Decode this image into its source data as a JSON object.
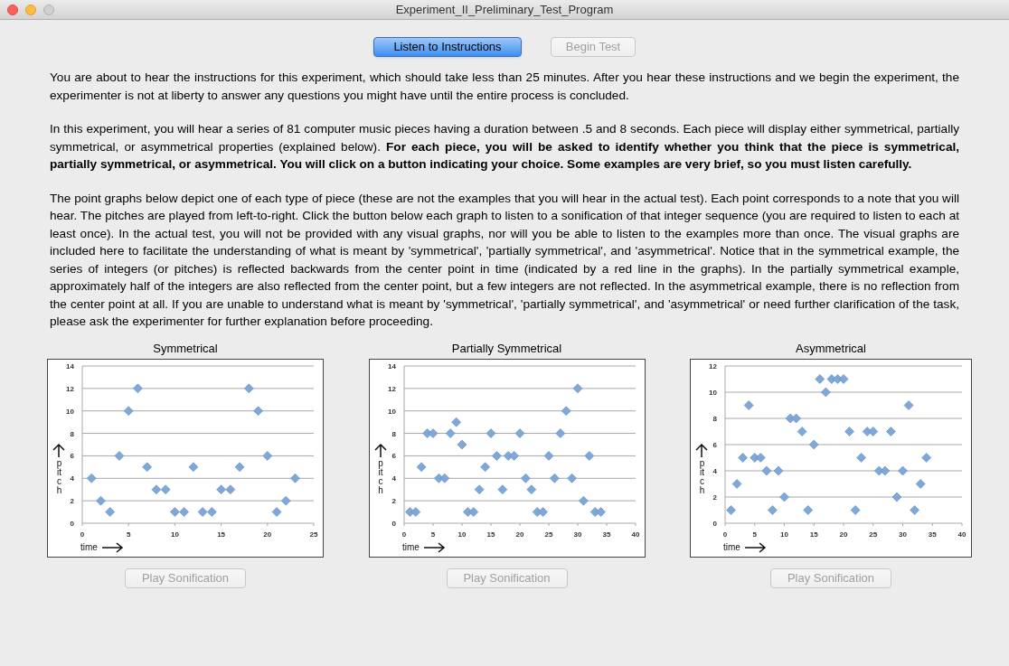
{
  "window": {
    "title": "Experiment_II_Preliminary_Test_Program"
  },
  "top_buttons": [
    {
      "label": "Listen to Instructions",
      "kind": "default",
      "disabled": false
    },
    {
      "label": "Begin Test",
      "kind": "normal",
      "disabled": true
    }
  ],
  "paragraphs": [
    "You are about to hear the instructions for this experiment, which should take less than 25 minutes. After you hear these instructions and we begin the experiment, the experimenter is not at liberty to answer any questions you might have until the entire process is concluded.",
    "In this experiment, you will hear a series of 81 computer music pieces having a duration between .5 and 8 seconds. Each piece will display either symmetrical, partially symmetrical, or asymmetrical properties (explained below). **For each piece, you will be asked to identify whether you think that the piece is symmetrical, partially symmetrical, or asymmetrical. You will click on a button indicating your choice. Some examples are very brief, so you must listen carefully.**",
    "The point graphs below depict one of each type of piece (these are not the examples that you will hear in the actual test). Each point corresponds to a note that you will hear. The pitches are played from left-to-right.  Click the button below each graph to listen to a sonification of that integer sequence (you are required to listen to each at least once). In the actual test, you will not be provided with any visual graphs, nor will you be able to listen to the examples more than once. The visual graphs are included here to facilitate the understanding of what is meant by 'symmetrical', 'partially symmetrical', and 'asymmetrical'. Notice that in the symmetrical example, the series of integers (or pitches) is reflected backwards from the center point in time (indicated by a red line in the graphs). In the partially symmetrical example, approximately half of the integers are also reflected from the center point, but a few integers are not reflected. In the asymmetrical example, there is no reflection from the center point at all.  If you are unable to understand what is meant by 'symmetrical', 'partially symmetrical', and 'asymmetrical' or need further clarification of the task, please ask the experimenter for further explanation before proceeding."
  ],
  "graphs": [
    {
      "chart_data": {
        "type": "scatter",
        "title": "Symmetrical",
        "xlabel": "time",
        "ylabel": "pitch",
        "x": [
          1,
          2,
          3,
          4,
          5,
          6,
          7,
          8,
          9,
          10,
          11,
          12,
          13,
          14,
          15,
          16,
          17,
          18,
          19,
          20,
          21,
          22,
          23
        ],
        "grid": true,
        "series": [
          {
            "color": "#7fa8d8",
            "values": [
              4,
              2,
              1,
              6,
              10,
              12,
              5,
              3,
              3,
              1,
              1,
              5,
              1,
              1,
              3,
              3,
              5,
              12,
              10,
              6,
              1,
              2,
              4
            ]
          }
        ],
        "xlim": [
          0,
          25
        ],
        "ylim": [
          0,
          14
        ],
        "xticks": [
          0,
          5,
          10,
          15,
          20,
          25
        ],
        "yticks": [
          0,
          2,
          4,
          6,
          8,
          10,
          12,
          14
        ]
      },
      "button": {
        "label": "Play Sonification",
        "disabled": true
      }
    },
    {
      "chart_data": {
        "type": "scatter",
        "title": "Partially Symmetrical",
        "xlabel": "time",
        "ylabel": "pitch",
        "x": [
          1,
          2,
          3,
          4,
          5,
          6,
          7,
          8,
          9,
          10,
          11,
          12,
          13,
          14,
          15,
          16,
          17,
          18,
          19,
          20,
          21,
          22,
          23,
          24,
          25,
          26,
          27,
          28,
          29,
          30,
          31,
          32,
          33,
          34
        ],
        "grid": true,
        "series": [
          {
            "color": "#7fa8d8",
            "values": [
              1,
              1,
              5,
              8,
              8,
              4,
              4,
              8,
              9,
              7,
              1,
              1,
              3,
              5,
              8,
              6,
              3,
              6,
              6,
              8,
              4,
              3,
              1,
              1,
              6,
              4,
              8,
              10,
              4,
              12,
              2,
              6,
              1,
              1
            ]
          }
        ],
        "xlim": [
          0,
          40
        ],
        "ylim": [
          0,
          14
        ],
        "xticks": [
          0,
          5,
          10,
          15,
          20,
          25,
          30,
          35,
          40
        ],
        "yticks": [
          0,
          2,
          4,
          6,
          8,
          10,
          12,
          14
        ]
      },
      "button": {
        "label": "Play Sonification",
        "disabled": true
      }
    },
    {
      "chart_data": {
        "type": "scatter",
        "title": "Asymmetrical",
        "xlabel": "time",
        "ylabel": "pitch",
        "x": [
          1,
          2,
          3,
          4,
          5,
          6,
          7,
          8,
          9,
          10,
          11,
          12,
          13,
          14,
          15,
          16,
          17,
          18,
          19,
          20,
          21,
          22,
          23,
          24,
          25,
          26,
          27,
          28,
          29,
          30,
          31,
          32,
          33,
          34
        ],
        "grid": true,
        "series": [
          {
            "color": "#7fa8d8",
            "values": [
              1,
              3,
              5,
              9,
              5,
              5,
              4,
              1,
              4,
              2,
              8,
              8,
              7,
              1,
              6,
              11,
              10,
              11,
              11,
              11,
              7,
              1,
              5,
              7,
              7,
              4,
              4,
              7,
              2,
              4,
              9,
              1,
              3,
              5
            ]
          }
        ],
        "xlim": [
          0,
          40
        ],
        "ylim": [
          0,
          12
        ],
        "xticks": [
          0,
          5,
          10,
          15,
          20,
          25,
          30,
          35,
          40
        ],
        "yticks": [
          0,
          2,
          4,
          6,
          8,
          10,
          12
        ]
      },
      "button": {
        "label": "Play Sonification",
        "disabled": true
      }
    }
  ]
}
